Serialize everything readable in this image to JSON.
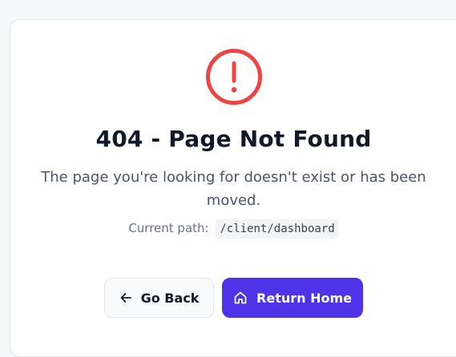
{
  "error": {
    "icon": "exclamation-circle-icon",
    "title": "404 - Page Not Found",
    "description": "The page you're looking for doesn't exist or has been moved.",
    "path_label": "Current path:",
    "path_value": "/client/dashboard"
  },
  "actions": {
    "back": {
      "label": "Go Back",
      "icon": "arrow-left-icon"
    },
    "home": {
      "label": "Return Home",
      "icon": "home-icon"
    }
  },
  "colors": {
    "error_red": "#ef4444",
    "primary": "#4f33e9",
    "title": "#111827",
    "muted": "#6b7280"
  }
}
